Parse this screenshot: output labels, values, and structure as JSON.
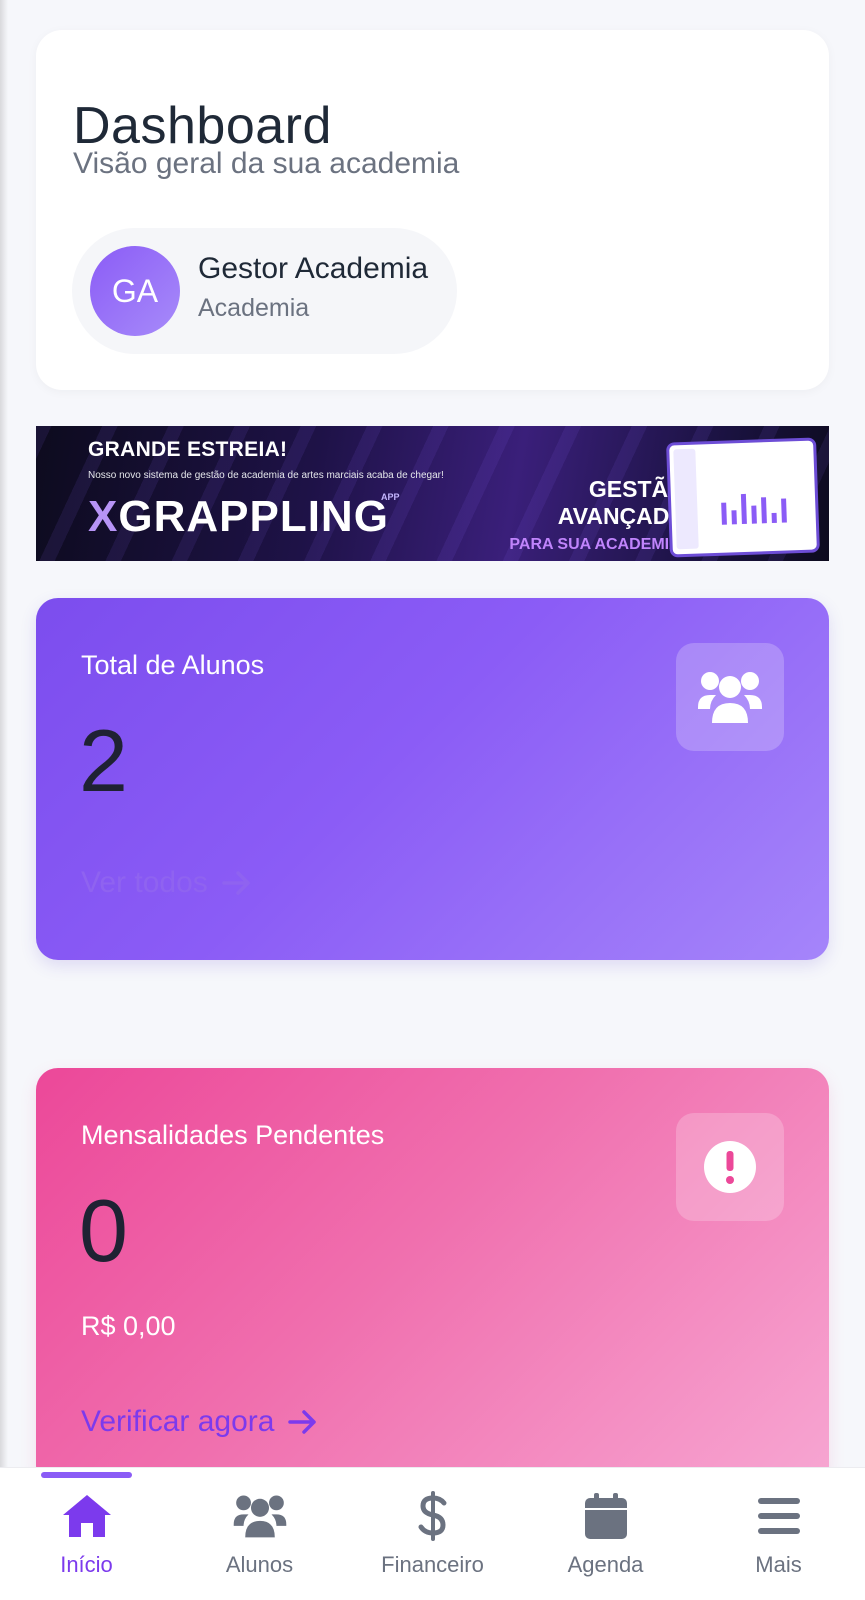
{
  "header": {
    "title": "Dashboard",
    "subtitle": "Visão geral da sua academia",
    "user": {
      "initials": "GA",
      "name": "Gestor Academia",
      "role": "Academia"
    }
  },
  "banner": {
    "headline": "GRANDE ESTREIA!",
    "tagline": "Nosso novo sistema de gestão de academia de artes marciais acaba de chegar!",
    "brand_x": "X",
    "brand_rest": "GRAPPLING",
    "brand_app": "APP",
    "right_line1": "GESTÃO",
    "right_line2": "AVANÇADA",
    "right_line3": "PARA SUA ACADEMIA!"
  },
  "cards": {
    "students": {
      "label": "Total de Alunos",
      "value": "2",
      "link": "Ver todos",
      "icon": "users-icon",
      "color": "#8b5cf6"
    },
    "pending": {
      "label": "Mensalidades Pendentes",
      "value": "0",
      "amount": "R$ 0,00",
      "link": "Verificar agora",
      "icon": "exclamation-circle-icon",
      "color": "#ec4899"
    }
  },
  "nav": {
    "active_color": "#7c3aed",
    "items": [
      {
        "label": "Início",
        "icon": "home-icon",
        "active": true
      },
      {
        "label": "Alunos",
        "icon": "users-icon",
        "active": false
      },
      {
        "label": "Financeiro",
        "icon": "dollar-icon",
        "active": false
      },
      {
        "label": "Agenda",
        "icon": "calendar-icon",
        "active": false
      },
      {
        "label": "Mais",
        "icon": "menu-icon",
        "active": false
      }
    ]
  }
}
